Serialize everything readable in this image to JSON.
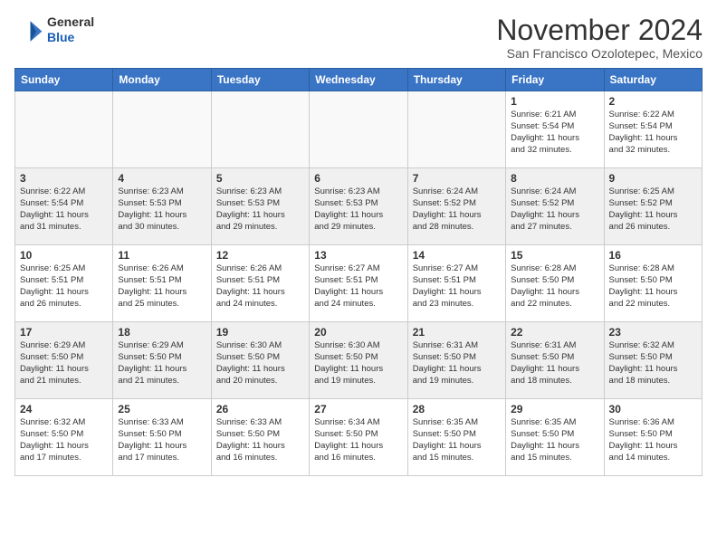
{
  "header": {
    "logo_line1": "General",
    "logo_line2": "Blue",
    "month": "November 2024",
    "location": "San Francisco Ozolotepec, Mexico"
  },
  "weekdays": [
    "Sunday",
    "Monday",
    "Tuesday",
    "Wednesday",
    "Thursday",
    "Friday",
    "Saturday"
  ],
  "weeks": [
    [
      {
        "day": "",
        "info": ""
      },
      {
        "day": "",
        "info": ""
      },
      {
        "day": "",
        "info": ""
      },
      {
        "day": "",
        "info": ""
      },
      {
        "day": "",
        "info": ""
      },
      {
        "day": "1",
        "info": "Sunrise: 6:21 AM\nSunset: 5:54 PM\nDaylight: 11 hours\nand 32 minutes."
      },
      {
        "day": "2",
        "info": "Sunrise: 6:22 AM\nSunset: 5:54 PM\nDaylight: 11 hours\nand 32 minutes."
      }
    ],
    [
      {
        "day": "3",
        "info": "Sunrise: 6:22 AM\nSunset: 5:54 PM\nDaylight: 11 hours\nand 31 minutes."
      },
      {
        "day": "4",
        "info": "Sunrise: 6:23 AM\nSunset: 5:53 PM\nDaylight: 11 hours\nand 30 minutes."
      },
      {
        "day": "5",
        "info": "Sunrise: 6:23 AM\nSunset: 5:53 PM\nDaylight: 11 hours\nand 29 minutes."
      },
      {
        "day": "6",
        "info": "Sunrise: 6:23 AM\nSunset: 5:53 PM\nDaylight: 11 hours\nand 29 minutes."
      },
      {
        "day": "7",
        "info": "Sunrise: 6:24 AM\nSunset: 5:52 PM\nDaylight: 11 hours\nand 28 minutes."
      },
      {
        "day": "8",
        "info": "Sunrise: 6:24 AM\nSunset: 5:52 PM\nDaylight: 11 hours\nand 27 minutes."
      },
      {
        "day": "9",
        "info": "Sunrise: 6:25 AM\nSunset: 5:52 PM\nDaylight: 11 hours\nand 26 minutes."
      }
    ],
    [
      {
        "day": "10",
        "info": "Sunrise: 6:25 AM\nSunset: 5:51 PM\nDaylight: 11 hours\nand 26 minutes."
      },
      {
        "day": "11",
        "info": "Sunrise: 6:26 AM\nSunset: 5:51 PM\nDaylight: 11 hours\nand 25 minutes."
      },
      {
        "day": "12",
        "info": "Sunrise: 6:26 AM\nSunset: 5:51 PM\nDaylight: 11 hours\nand 24 minutes."
      },
      {
        "day": "13",
        "info": "Sunrise: 6:27 AM\nSunset: 5:51 PM\nDaylight: 11 hours\nand 24 minutes."
      },
      {
        "day": "14",
        "info": "Sunrise: 6:27 AM\nSunset: 5:51 PM\nDaylight: 11 hours\nand 23 minutes."
      },
      {
        "day": "15",
        "info": "Sunrise: 6:28 AM\nSunset: 5:50 PM\nDaylight: 11 hours\nand 22 minutes."
      },
      {
        "day": "16",
        "info": "Sunrise: 6:28 AM\nSunset: 5:50 PM\nDaylight: 11 hours\nand 22 minutes."
      }
    ],
    [
      {
        "day": "17",
        "info": "Sunrise: 6:29 AM\nSunset: 5:50 PM\nDaylight: 11 hours\nand 21 minutes."
      },
      {
        "day": "18",
        "info": "Sunrise: 6:29 AM\nSunset: 5:50 PM\nDaylight: 11 hours\nand 21 minutes."
      },
      {
        "day": "19",
        "info": "Sunrise: 6:30 AM\nSunset: 5:50 PM\nDaylight: 11 hours\nand 20 minutes."
      },
      {
        "day": "20",
        "info": "Sunrise: 6:30 AM\nSunset: 5:50 PM\nDaylight: 11 hours\nand 19 minutes."
      },
      {
        "day": "21",
        "info": "Sunrise: 6:31 AM\nSunset: 5:50 PM\nDaylight: 11 hours\nand 19 minutes."
      },
      {
        "day": "22",
        "info": "Sunrise: 6:31 AM\nSunset: 5:50 PM\nDaylight: 11 hours\nand 18 minutes."
      },
      {
        "day": "23",
        "info": "Sunrise: 6:32 AM\nSunset: 5:50 PM\nDaylight: 11 hours\nand 18 minutes."
      }
    ],
    [
      {
        "day": "24",
        "info": "Sunrise: 6:32 AM\nSunset: 5:50 PM\nDaylight: 11 hours\nand 17 minutes."
      },
      {
        "day": "25",
        "info": "Sunrise: 6:33 AM\nSunset: 5:50 PM\nDaylight: 11 hours\nand 17 minutes."
      },
      {
        "day": "26",
        "info": "Sunrise: 6:33 AM\nSunset: 5:50 PM\nDaylight: 11 hours\nand 16 minutes."
      },
      {
        "day": "27",
        "info": "Sunrise: 6:34 AM\nSunset: 5:50 PM\nDaylight: 11 hours\nand 16 minutes."
      },
      {
        "day": "28",
        "info": "Sunrise: 6:35 AM\nSunset: 5:50 PM\nDaylight: 11 hours\nand 15 minutes."
      },
      {
        "day": "29",
        "info": "Sunrise: 6:35 AM\nSunset: 5:50 PM\nDaylight: 11 hours\nand 15 minutes."
      },
      {
        "day": "30",
        "info": "Sunrise: 6:36 AM\nSunset: 5:50 PM\nDaylight: 11 hours\nand 14 minutes."
      }
    ]
  ]
}
